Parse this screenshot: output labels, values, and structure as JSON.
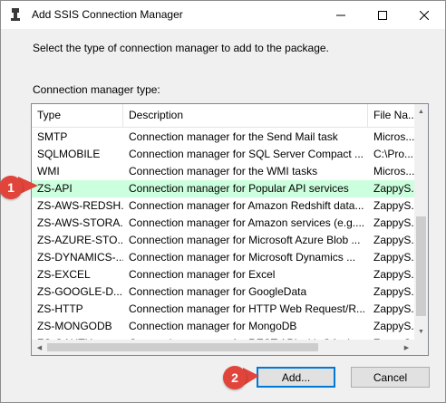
{
  "window": {
    "title": "Add SSIS Connection Manager",
    "minimize_glyph": "—",
    "maximize_glyph": "☐",
    "close_glyph": "✕"
  },
  "prompt": "Select the type of connection manager to add to the package.",
  "list_label": "Connection manager type:",
  "columns": {
    "type": "Type",
    "description": "Description",
    "file": "File Na..."
  },
  "rows": [
    {
      "type": "SMTP",
      "description": "Connection manager for the Send Mail task",
      "file": "Micros..."
    },
    {
      "type": "SQLMOBILE",
      "description": "Connection manager for SQL Server Compact ...",
      "file": "C:\\Pro..."
    },
    {
      "type": "WMI",
      "description": "Connection manager for the WMI tasks",
      "file": "Micros..."
    },
    {
      "type": "ZS-API",
      "description": "Connection manager for Popular API services",
      "file": "ZappyS..."
    },
    {
      "type": "ZS-AWS-REDSH...",
      "description": "Connection manager for Amazon Redshift data...",
      "file": "ZappyS..."
    },
    {
      "type": "ZS-AWS-STORA...",
      "description": "Connection manager for Amazon services (e.g....",
      "file": "ZappyS..."
    },
    {
      "type": "ZS-AZURE-STO...",
      "description": "Connection manager for Microsoft Azure Blob ...",
      "file": "ZappyS..."
    },
    {
      "type": "ZS-DYNAMICS-...",
      "description": "Connection manager for Microsoft Dynamics ...",
      "file": "ZappyS..."
    },
    {
      "type": "ZS-EXCEL",
      "description": "Connection manager for Excel",
      "file": "ZappyS..."
    },
    {
      "type": "ZS-GOOGLE-D...",
      "description": "Connection manager for GoogleData",
      "file": "ZappyS..."
    },
    {
      "type": "ZS-HTTP",
      "description": "Connection manager for HTTP Web Request/R...",
      "file": "ZappyS..."
    },
    {
      "type": "ZS-MONGODB",
      "description": "Connection manager for MongoDB",
      "file": "ZappyS..."
    },
    {
      "type": "ZS-OAUTH",
      "description": "Connection manager for REST API with OAuth...",
      "file": "ZappyS..."
    }
  ],
  "selected_row": 3,
  "scroll_glyphs": {
    "up": "▲",
    "down": "▼",
    "left": "◀",
    "right": "▶"
  },
  "buttons": {
    "add": "Add...",
    "cancel": "Cancel"
  },
  "callouts": {
    "one": "1",
    "two": "2"
  },
  "colors": {
    "selection": "#ccffdd",
    "callout": "#e0443a",
    "focus_border": "#0078d7"
  }
}
